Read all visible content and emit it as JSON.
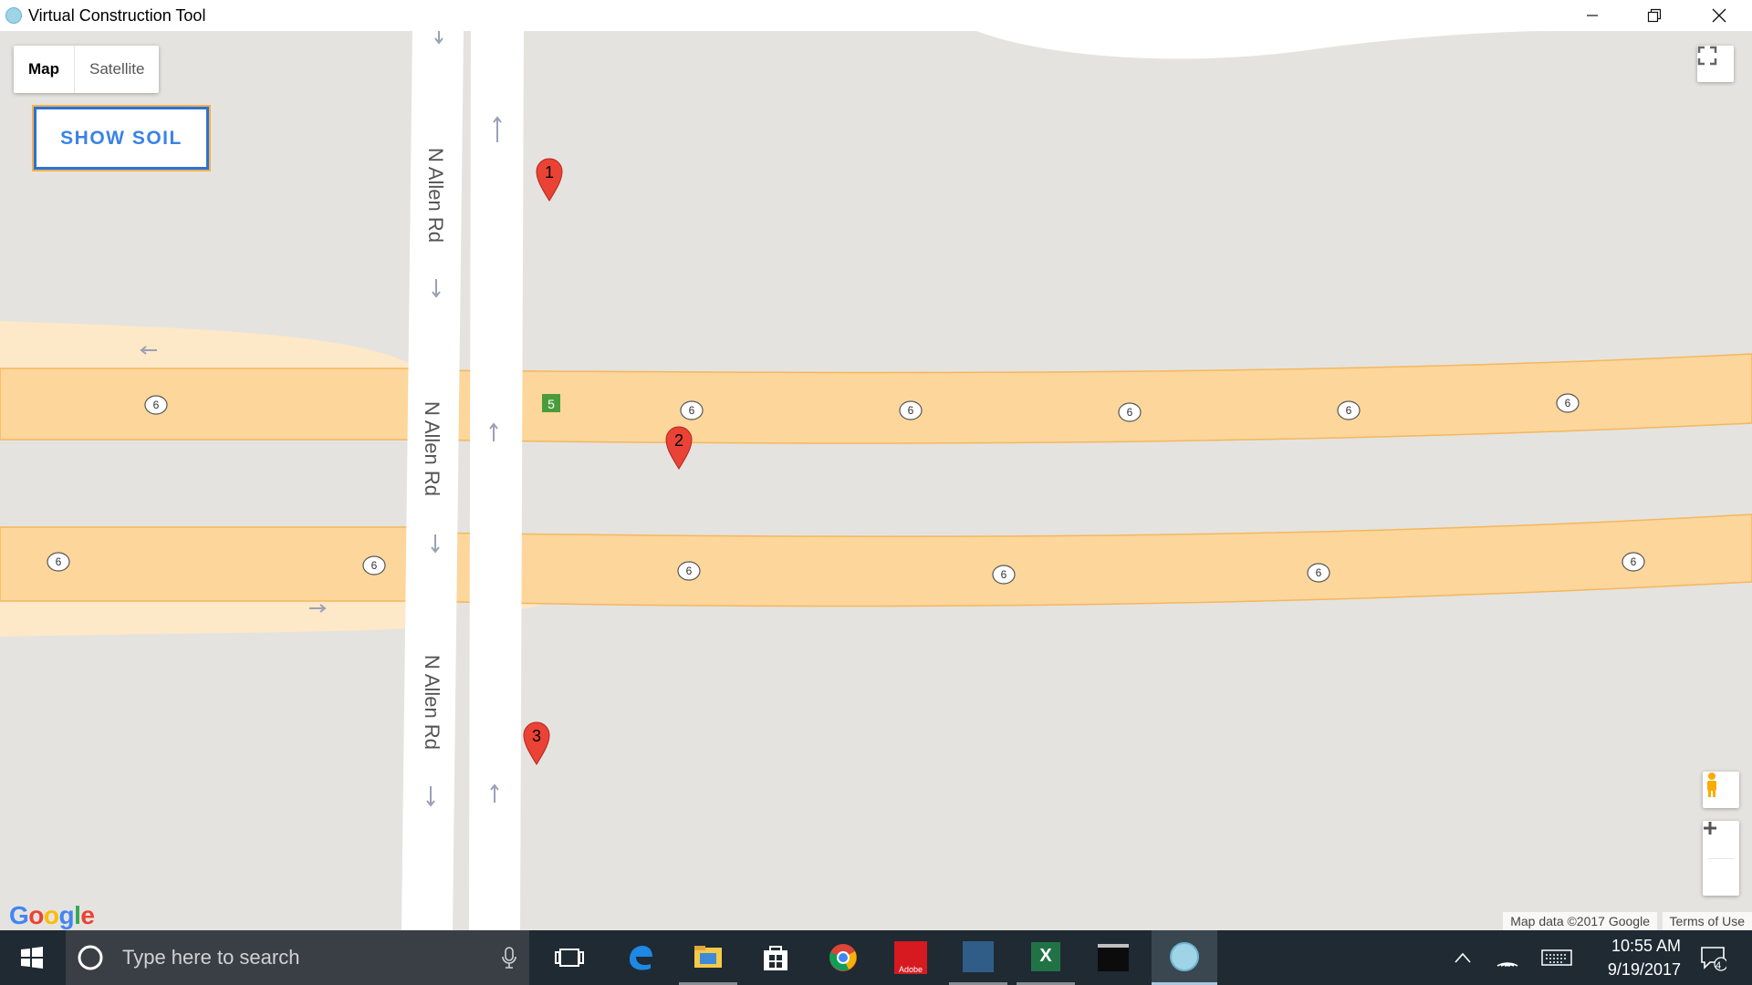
{
  "window": {
    "title": "Virtual Construction Tool",
    "minimize_icon": "minimize-icon",
    "restore_icon": "restore-icon",
    "close_icon": "close-icon"
  },
  "map": {
    "type_control": {
      "map_label": "Map",
      "satellite_label": "Satellite",
      "selected": "Map"
    },
    "show_soil_label": "SHOW SOIL",
    "road_labels": [
      "N Allen Rd",
      "N Allen Rd",
      "N Allen Rd"
    ],
    "route_shields": [
      "6",
      "6",
      "6",
      "6",
      "6",
      "6",
      "6",
      "6",
      "6",
      "6",
      "6",
      "6"
    ],
    "exit_badge": "5",
    "markers": [
      "1",
      "2",
      "3"
    ],
    "logo": "Google",
    "attribution": "Map data ©2017 Google",
    "terms": "Terms of Use",
    "colors": {
      "highway": "#fdd69b",
      "highway_edge": "#f3b75e",
      "land": "#e5e3df",
      "road": "#ffffff",
      "marker": "#ea4335",
      "button_border": "#2b71d8",
      "button_text": "#3b82e6"
    }
  },
  "taskbar": {
    "search_placeholder": "Type here to search",
    "time": "10:55 AM",
    "date": "9/19/2017",
    "notification_count": "4",
    "apps": [
      "task-view-icon",
      "edge-icon",
      "file-explorer-icon",
      "store-icon",
      "chrome-icon",
      "adobe-icon",
      "mysql-workbench-icon",
      "excel-icon",
      "terminal-icon",
      "virtual-construction-tool-icon"
    ],
    "adobe_label": "Adobe"
  }
}
